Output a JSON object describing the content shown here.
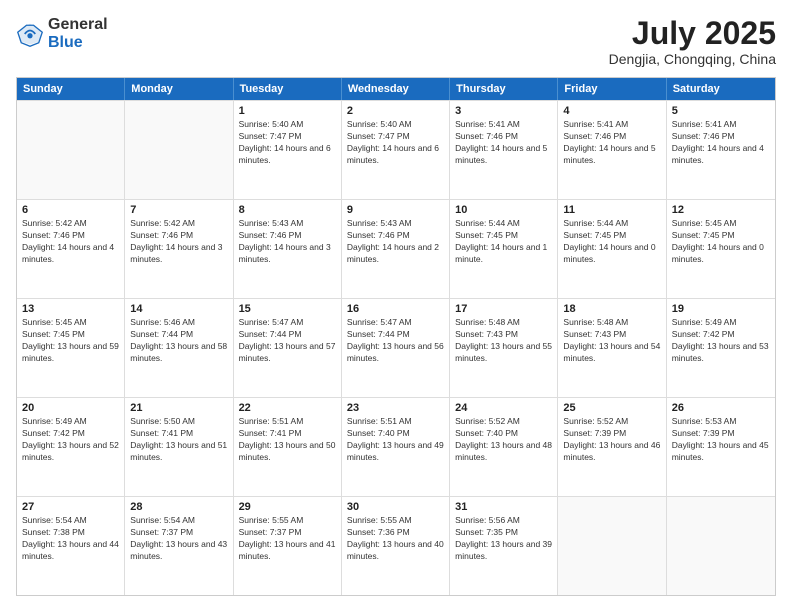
{
  "header": {
    "logo_general": "General",
    "logo_blue": "Blue",
    "title": "July 2025",
    "subtitle": "Dengjia, Chongqing, China"
  },
  "days_of_week": [
    "Sunday",
    "Monday",
    "Tuesday",
    "Wednesday",
    "Thursday",
    "Friday",
    "Saturday"
  ],
  "weeks": [
    [
      {
        "day": "",
        "empty": true
      },
      {
        "day": "",
        "empty": true
      },
      {
        "day": "1",
        "sunrise": "Sunrise: 5:40 AM",
        "sunset": "Sunset: 7:47 PM",
        "daylight": "Daylight: 14 hours and 6 minutes."
      },
      {
        "day": "2",
        "sunrise": "Sunrise: 5:40 AM",
        "sunset": "Sunset: 7:47 PM",
        "daylight": "Daylight: 14 hours and 6 minutes."
      },
      {
        "day": "3",
        "sunrise": "Sunrise: 5:41 AM",
        "sunset": "Sunset: 7:46 PM",
        "daylight": "Daylight: 14 hours and 5 minutes."
      },
      {
        "day": "4",
        "sunrise": "Sunrise: 5:41 AM",
        "sunset": "Sunset: 7:46 PM",
        "daylight": "Daylight: 14 hours and 5 minutes."
      },
      {
        "day": "5",
        "sunrise": "Sunrise: 5:41 AM",
        "sunset": "Sunset: 7:46 PM",
        "daylight": "Daylight: 14 hours and 4 minutes."
      }
    ],
    [
      {
        "day": "6",
        "sunrise": "Sunrise: 5:42 AM",
        "sunset": "Sunset: 7:46 PM",
        "daylight": "Daylight: 14 hours and 4 minutes."
      },
      {
        "day": "7",
        "sunrise": "Sunrise: 5:42 AM",
        "sunset": "Sunset: 7:46 PM",
        "daylight": "Daylight: 14 hours and 3 minutes."
      },
      {
        "day": "8",
        "sunrise": "Sunrise: 5:43 AM",
        "sunset": "Sunset: 7:46 PM",
        "daylight": "Daylight: 14 hours and 3 minutes."
      },
      {
        "day": "9",
        "sunrise": "Sunrise: 5:43 AM",
        "sunset": "Sunset: 7:46 PM",
        "daylight": "Daylight: 14 hours and 2 minutes."
      },
      {
        "day": "10",
        "sunrise": "Sunrise: 5:44 AM",
        "sunset": "Sunset: 7:45 PM",
        "daylight": "Daylight: 14 hours and 1 minute."
      },
      {
        "day": "11",
        "sunrise": "Sunrise: 5:44 AM",
        "sunset": "Sunset: 7:45 PM",
        "daylight": "Daylight: 14 hours and 0 minutes."
      },
      {
        "day": "12",
        "sunrise": "Sunrise: 5:45 AM",
        "sunset": "Sunset: 7:45 PM",
        "daylight": "Daylight: 14 hours and 0 minutes."
      }
    ],
    [
      {
        "day": "13",
        "sunrise": "Sunrise: 5:45 AM",
        "sunset": "Sunset: 7:45 PM",
        "daylight": "Daylight: 13 hours and 59 minutes."
      },
      {
        "day": "14",
        "sunrise": "Sunrise: 5:46 AM",
        "sunset": "Sunset: 7:44 PM",
        "daylight": "Daylight: 13 hours and 58 minutes."
      },
      {
        "day": "15",
        "sunrise": "Sunrise: 5:47 AM",
        "sunset": "Sunset: 7:44 PM",
        "daylight": "Daylight: 13 hours and 57 minutes."
      },
      {
        "day": "16",
        "sunrise": "Sunrise: 5:47 AM",
        "sunset": "Sunset: 7:44 PM",
        "daylight": "Daylight: 13 hours and 56 minutes."
      },
      {
        "day": "17",
        "sunrise": "Sunrise: 5:48 AM",
        "sunset": "Sunset: 7:43 PM",
        "daylight": "Daylight: 13 hours and 55 minutes."
      },
      {
        "day": "18",
        "sunrise": "Sunrise: 5:48 AM",
        "sunset": "Sunset: 7:43 PM",
        "daylight": "Daylight: 13 hours and 54 minutes."
      },
      {
        "day": "19",
        "sunrise": "Sunrise: 5:49 AM",
        "sunset": "Sunset: 7:42 PM",
        "daylight": "Daylight: 13 hours and 53 minutes."
      }
    ],
    [
      {
        "day": "20",
        "sunrise": "Sunrise: 5:49 AM",
        "sunset": "Sunset: 7:42 PM",
        "daylight": "Daylight: 13 hours and 52 minutes."
      },
      {
        "day": "21",
        "sunrise": "Sunrise: 5:50 AM",
        "sunset": "Sunset: 7:41 PM",
        "daylight": "Daylight: 13 hours and 51 minutes."
      },
      {
        "day": "22",
        "sunrise": "Sunrise: 5:51 AM",
        "sunset": "Sunset: 7:41 PM",
        "daylight": "Daylight: 13 hours and 50 minutes."
      },
      {
        "day": "23",
        "sunrise": "Sunrise: 5:51 AM",
        "sunset": "Sunset: 7:40 PM",
        "daylight": "Daylight: 13 hours and 49 minutes."
      },
      {
        "day": "24",
        "sunrise": "Sunrise: 5:52 AM",
        "sunset": "Sunset: 7:40 PM",
        "daylight": "Daylight: 13 hours and 48 minutes."
      },
      {
        "day": "25",
        "sunrise": "Sunrise: 5:52 AM",
        "sunset": "Sunset: 7:39 PM",
        "daylight": "Daylight: 13 hours and 46 minutes."
      },
      {
        "day": "26",
        "sunrise": "Sunrise: 5:53 AM",
        "sunset": "Sunset: 7:39 PM",
        "daylight": "Daylight: 13 hours and 45 minutes."
      }
    ],
    [
      {
        "day": "27",
        "sunrise": "Sunrise: 5:54 AM",
        "sunset": "Sunset: 7:38 PM",
        "daylight": "Daylight: 13 hours and 44 minutes."
      },
      {
        "day": "28",
        "sunrise": "Sunrise: 5:54 AM",
        "sunset": "Sunset: 7:37 PM",
        "daylight": "Daylight: 13 hours and 43 minutes."
      },
      {
        "day": "29",
        "sunrise": "Sunrise: 5:55 AM",
        "sunset": "Sunset: 7:37 PM",
        "daylight": "Daylight: 13 hours and 41 minutes."
      },
      {
        "day": "30",
        "sunrise": "Sunrise: 5:55 AM",
        "sunset": "Sunset: 7:36 PM",
        "daylight": "Daylight: 13 hours and 40 minutes."
      },
      {
        "day": "31",
        "sunrise": "Sunrise: 5:56 AM",
        "sunset": "Sunset: 7:35 PM",
        "daylight": "Daylight: 13 hours and 39 minutes."
      },
      {
        "day": "",
        "empty": true
      },
      {
        "day": "",
        "empty": true
      }
    ]
  ]
}
